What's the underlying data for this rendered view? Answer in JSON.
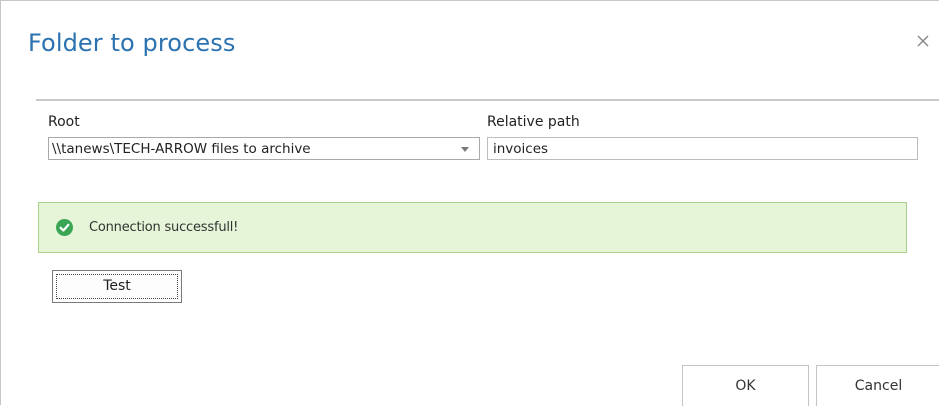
{
  "dialog": {
    "title": "Folder to process",
    "close_icon": "close-icon"
  },
  "form": {
    "root_label": "Root",
    "root_value": "\\\\tanews\\TECH-ARROW files to archive",
    "relative_path_label": "Relative path",
    "relative_path_value": "invoices"
  },
  "alert": {
    "icon": "check-circle-icon",
    "message": "Connection successfull!",
    "accent_color": "#3aa655"
  },
  "buttons": {
    "test_label": "Test",
    "ok_label": "OK",
    "cancel_label": "Cancel"
  }
}
